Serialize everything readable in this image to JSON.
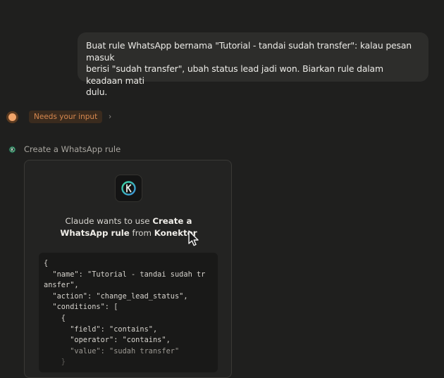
{
  "user_message": {
    "line1": "Buat rule WhatsApp bernama \"Tutorial - tandai sudah transfer\": kalau pesan masuk",
    "line2": "berisi \"sudah transfer\", ubah status lead jadi won. Biarkan rule dalam keadaan mati",
    "line3": "dulu."
  },
  "status": {
    "badge": "Needs your input",
    "chevron": "›",
    "color": "#f0a46a"
  },
  "tool_call": {
    "label": "Create a WhatsApp rule"
  },
  "permission": {
    "prefix": "Claude wants to use ",
    "action": "Create a WhatsApp rule",
    "middle": " from ",
    "app": "Konektor"
  },
  "code": {
    "l1": "{",
    "l2": "  \"name\": \"Tutorial - tandai sudah tr",
    "l3": "ansfer\",",
    "l4": "  \"action\": \"change_lead_status\",",
    "l5": "  \"conditions\": [",
    "l6": "    {",
    "l7": "      \"field\": \"contains\",",
    "l8": "      \"operator\": \"contains\",",
    "l9": "      \"value\": \"sudah transfer\"",
    "l10": "    }"
  }
}
